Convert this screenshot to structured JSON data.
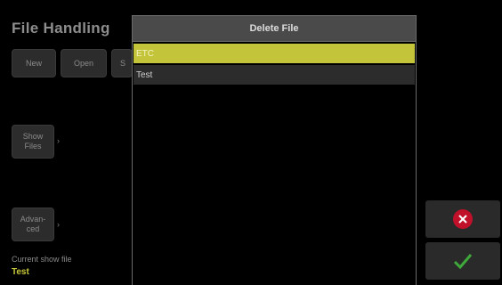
{
  "app": {
    "title": "File Handling"
  },
  "toolbar": {
    "new_label": "New",
    "open_label": "Open",
    "save_label": "S"
  },
  "side_nav": {
    "show_files_label": "Show\nFiles",
    "advanced_label": "Advan-\nced",
    "arrow": "›"
  },
  "current_show": {
    "label": "Current show file",
    "value": "Test"
  },
  "dialog": {
    "title": "Delete File",
    "files": [
      {
        "name": "ETC",
        "selected": true
      },
      {
        "name": "Test",
        "selected": false
      }
    ]
  },
  "actions": {
    "cancel_icon": "cancel-icon",
    "confirm_icon": "checkmark-icon"
  },
  "colors": {
    "selected_row": "#c4c43a",
    "accent_yellow": "#c8c83a",
    "cancel_red": "#c0102a",
    "confirm_green": "#3fa83a"
  }
}
